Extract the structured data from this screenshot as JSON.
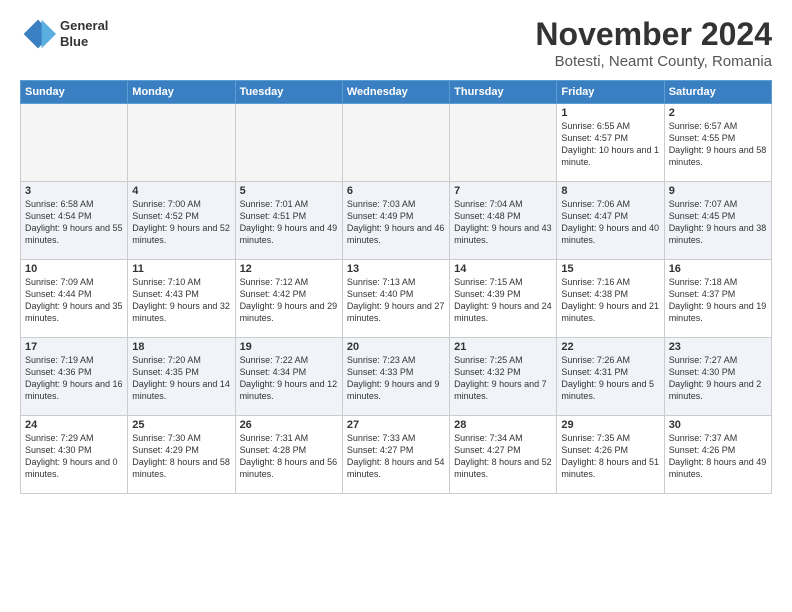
{
  "header": {
    "month": "November 2024",
    "location": "Botesti, Neamt County, Romania",
    "logo_line1": "General",
    "logo_line2": "Blue"
  },
  "weekdays": [
    "Sunday",
    "Monday",
    "Tuesday",
    "Wednesday",
    "Thursday",
    "Friday",
    "Saturday"
  ],
  "weeks": [
    [
      {
        "day": "",
        "info": ""
      },
      {
        "day": "",
        "info": ""
      },
      {
        "day": "",
        "info": ""
      },
      {
        "day": "",
        "info": ""
      },
      {
        "day": "",
        "info": ""
      },
      {
        "day": "1",
        "info": "Sunrise: 6:55 AM\nSunset: 4:57 PM\nDaylight: 10 hours and 1 minute."
      },
      {
        "day": "2",
        "info": "Sunrise: 6:57 AM\nSunset: 4:55 PM\nDaylight: 9 hours and 58 minutes."
      }
    ],
    [
      {
        "day": "3",
        "info": "Sunrise: 6:58 AM\nSunset: 4:54 PM\nDaylight: 9 hours and 55 minutes."
      },
      {
        "day": "4",
        "info": "Sunrise: 7:00 AM\nSunset: 4:52 PM\nDaylight: 9 hours and 52 minutes."
      },
      {
        "day": "5",
        "info": "Sunrise: 7:01 AM\nSunset: 4:51 PM\nDaylight: 9 hours and 49 minutes."
      },
      {
        "day": "6",
        "info": "Sunrise: 7:03 AM\nSunset: 4:49 PM\nDaylight: 9 hours and 46 minutes."
      },
      {
        "day": "7",
        "info": "Sunrise: 7:04 AM\nSunset: 4:48 PM\nDaylight: 9 hours and 43 minutes."
      },
      {
        "day": "8",
        "info": "Sunrise: 7:06 AM\nSunset: 4:47 PM\nDaylight: 9 hours and 40 minutes."
      },
      {
        "day": "9",
        "info": "Sunrise: 7:07 AM\nSunset: 4:45 PM\nDaylight: 9 hours and 38 minutes."
      }
    ],
    [
      {
        "day": "10",
        "info": "Sunrise: 7:09 AM\nSunset: 4:44 PM\nDaylight: 9 hours and 35 minutes."
      },
      {
        "day": "11",
        "info": "Sunrise: 7:10 AM\nSunset: 4:43 PM\nDaylight: 9 hours and 32 minutes."
      },
      {
        "day": "12",
        "info": "Sunrise: 7:12 AM\nSunset: 4:42 PM\nDaylight: 9 hours and 29 minutes."
      },
      {
        "day": "13",
        "info": "Sunrise: 7:13 AM\nSunset: 4:40 PM\nDaylight: 9 hours and 27 minutes."
      },
      {
        "day": "14",
        "info": "Sunrise: 7:15 AM\nSunset: 4:39 PM\nDaylight: 9 hours and 24 minutes."
      },
      {
        "day": "15",
        "info": "Sunrise: 7:16 AM\nSunset: 4:38 PM\nDaylight: 9 hours and 21 minutes."
      },
      {
        "day": "16",
        "info": "Sunrise: 7:18 AM\nSunset: 4:37 PM\nDaylight: 9 hours and 19 minutes."
      }
    ],
    [
      {
        "day": "17",
        "info": "Sunrise: 7:19 AM\nSunset: 4:36 PM\nDaylight: 9 hours and 16 minutes."
      },
      {
        "day": "18",
        "info": "Sunrise: 7:20 AM\nSunset: 4:35 PM\nDaylight: 9 hours and 14 minutes."
      },
      {
        "day": "19",
        "info": "Sunrise: 7:22 AM\nSunset: 4:34 PM\nDaylight: 9 hours and 12 minutes."
      },
      {
        "day": "20",
        "info": "Sunrise: 7:23 AM\nSunset: 4:33 PM\nDaylight: 9 hours and 9 minutes."
      },
      {
        "day": "21",
        "info": "Sunrise: 7:25 AM\nSunset: 4:32 PM\nDaylight: 9 hours and 7 minutes."
      },
      {
        "day": "22",
        "info": "Sunrise: 7:26 AM\nSunset: 4:31 PM\nDaylight: 9 hours and 5 minutes."
      },
      {
        "day": "23",
        "info": "Sunrise: 7:27 AM\nSunset: 4:30 PM\nDaylight: 9 hours and 2 minutes."
      }
    ],
    [
      {
        "day": "24",
        "info": "Sunrise: 7:29 AM\nSunset: 4:30 PM\nDaylight: 9 hours and 0 minutes."
      },
      {
        "day": "25",
        "info": "Sunrise: 7:30 AM\nSunset: 4:29 PM\nDaylight: 8 hours and 58 minutes."
      },
      {
        "day": "26",
        "info": "Sunrise: 7:31 AM\nSunset: 4:28 PM\nDaylight: 8 hours and 56 minutes."
      },
      {
        "day": "27",
        "info": "Sunrise: 7:33 AM\nSunset: 4:27 PM\nDaylight: 8 hours and 54 minutes."
      },
      {
        "day": "28",
        "info": "Sunrise: 7:34 AM\nSunset: 4:27 PM\nDaylight: 8 hours and 52 minutes."
      },
      {
        "day": "29",
        "info": "Sunrise: 7:35 AM\nSunset: 4:26 PM\nDaylight: 8 hours and 51 minutes."
      },
      {
        "day": "30",
        "info": "Sunrise: 7:37 AM\nSunset: 4:26 PM\nDaylight: 8 hours and 49 minutes."
      }
    ]
  ]
}
